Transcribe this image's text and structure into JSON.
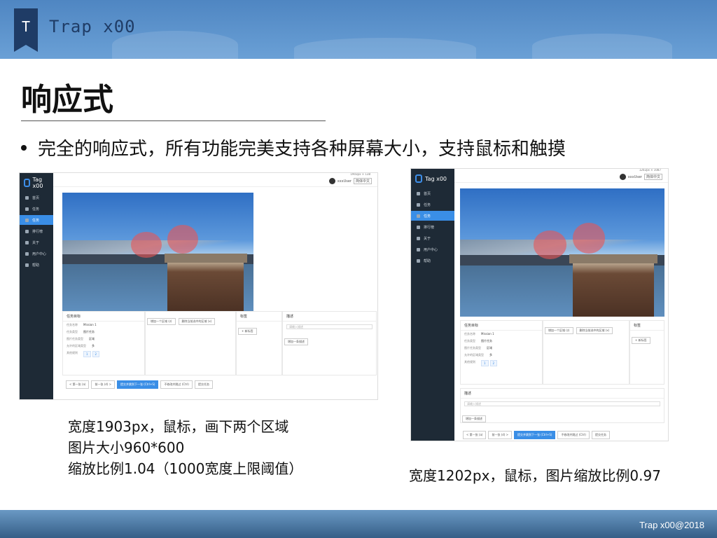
{
  "header": {
    "logo_letter": "T",
    "brand": "Trap x00"
  },
  "slide": {
    "title": "响应式",
    "bullet": "完全的响应式，所有功能完美支持各种屏幕大小，支持鼠标和触摸"
  },
  "left_caption": {
    "line1": "宽度1903px，鼠标，画下两个区域",
    "line2": "图片大小960*600",
    "line3": "缩放比例1.04（1000宽度上限阈值）"
  },
  "right_caption": "宽度1202px，鼠标，图片缩放比例0.97",
  "footer": "Trap x00@2018",
  "app": {
    "logo_text": "Tag x00",
    "menu": [
      "首页",
      "任务",
      "任务",
      "排行榜",
      "关于",
      "用户中心",
      "帮助"
    ],
    "user": "xxxUser",
    "lang": "简体中文",
    "stats_left": "1903px × 138",
    "stats_right": "1202px × 1087",
    "info_panel_title": "任务目标",
    "info_rows": [
      {
        "k": "任务名称",
        "v": "Mission 1"
      },
      {
        "k": "任务类型",
        "v": "图片任务"
      },
      {
        "k": "图片任务类型",
        "v": "区域"
      },
      {
        "k": "允许的区域类型",
        "v": "多"
      },
      {
        "k": "其他规则",
        "v": ""
      }
    ],
    "tag_panel_title": "标签",
    "tag_add": "+ 新标签",
    "desc_panel_title": "描述",
    "desc_placeholder": "请输入描述",
    "desc_btn": "增加一条描述",
    "region_btns": [
      "增加一个区域 (z)",
      "删除当前选中的区域 (x)"
    ],
    "bottom_btns": [
      "< 第一张 (a)",
      "前一张 (d) >",
      "提交并跳到下一张 (Ctrl+S)",
      "不修改并跳过 (Ctrl)",
      "提交任务"
    ],
    "chips": [
      "1",
      "2"
    ]
  }
}
